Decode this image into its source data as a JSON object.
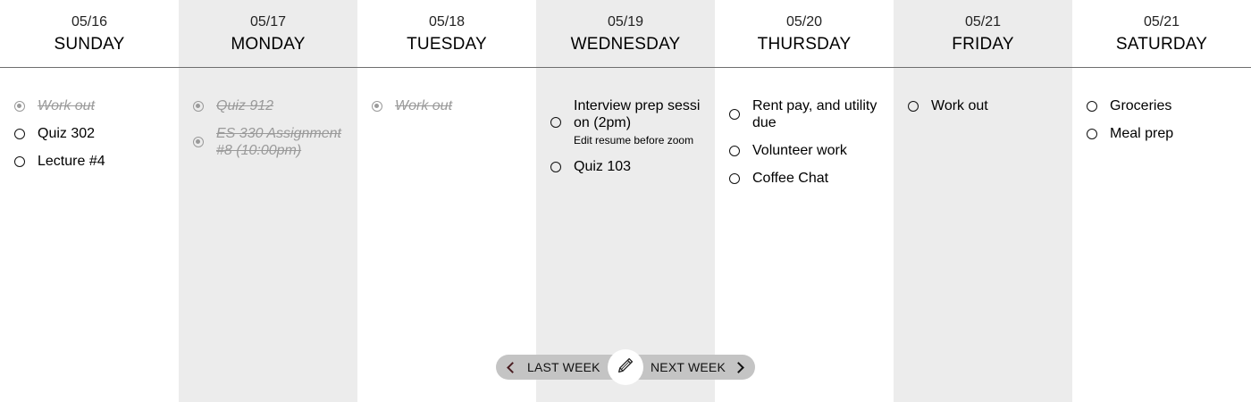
{
  "days": [
    {
      "date": "05/16",
      "name": "SUNDAY",
      "tasks": [
        {
          "label": "Work out",
          "done": true
        },
        {
          "label": "Quiz 302",
          "done": false
        },
        {
          "label": "Lecture #4",
          "done": false
        }
      ]
    },
    {
      "date": "05/17",
      "name": "MONDAY",
      "tasks": [
        {
          "label": "Quiz 912",
          "done": true
        },
        {
          "label": "ES 330 Assignment #8 (10:00pm)",
          "done": true
        }
      ]
    },
    {
      "date": "05/18",
      "name": "TUESDAY",
      "tasks": [
        {
          "label": "Work out",
          "done": true
        }
      ]
    },
    {
      "date": "05/19",
      "name": "WEDNESDAY",
      "tasks": [
        {
          "label": "Interview prep session (2pm)",
          "note": "Edit resume before zoom",
          "done": false
        },
        {
          "label": "Quiz 103",
          "done": false
        }
      ]
    },
    {
      "date": "05/20",
      "name": "THURSDAY",
      "tasks": [
        {
          "label": "Rent pay, and utility due",
          "done": false
        },
        {
          "label": "Volunteer work",
          "done": false
        },
        {
          "label": "Coffee Chat",
          "done": false
        }
      ]
    },
    {
      "date": "05/21",
      "name": "FRIDAY",
      "tasks": [
        {
          "label": "Work out",
          "done": false
        }
      ]
    },
    {
      "date": "05/21",
      "name": "SATURDAY",
      "tasks": [
        {
          "label": "Groceries",
          "done": false
        },
        {
          "label": "Meal prep",
          "done": false
        }
      ]
    }
  ],
  "nav": {
    "prev_label": "LAST WEEK",
    "next_label": "NEXT WEEK",
    "edit_icon": "pencil-icon"
  },
  "colors": {
    "shaded_column": "#ececec",
    "completed_text": "#9a9a9a",
    "nav_pill": "#c4c4c4"
  }
}
